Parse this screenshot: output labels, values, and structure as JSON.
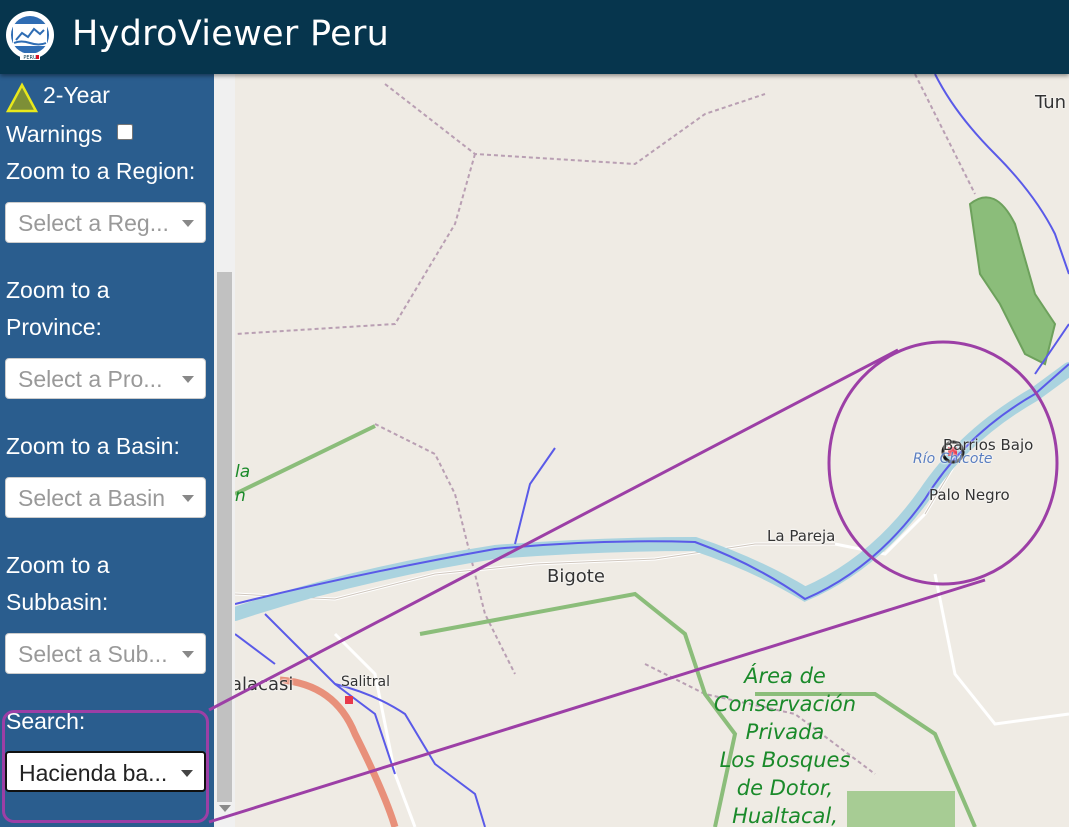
{
  "header": {
    "title": "HydroViewer Peru",
    "logo_text": "PERU"
  },
  "sidebar": {
    "warning_label": "2-Year",
    "warning_label_2": "Warnings",
    "region_label": "Zoom to a Region:",
    "region_placeholder": "Select a Reg...",
    "province_label_1": "Zoom to a",
    "province_label_2": "Province:",
    "province_placeholder": "Select a Pro...",
    "basin_label": "Zoom to a Basin:",
    "basin_placeholder": "Select a Basin",
    "subbasin_label_1": "Zoom to a",
    "subbasin_label_2": "Subbasin:",
    "subbasin_placeholder": "Select a Sub...",
    "search_label": "Search:",
    "search_value": "Hacienda ba..."
  },
  "map": {
    "places": {
      "tun": "Tun",
      "barrios_bajo": "Barrios Bajo",
      "rio": "Río Chicote",
      "palo_negro": "Palo Negro",
      "la_pareja": "La Pareja",
      "bigote": "Bigote",
      "salitral": "Salitral",
      "malacasi": "alacasi",
      "edge_a": "la",
      "edge_b": "n"
    },
    "area": [
      "Área de",
      "Conservación",
      "Privada",
      "Los Bosques",
      "de Dotor,",
      "Hualtacal,"
    ]
  },
  "colors": {
    "header_bg": "#06354d",
    "sidebar_bg": "#2a5d8e",
    "highlight": "#9c3fa6",
    "river": "#5a5ae8",
    "river_fill": "#aad3df",
    "protected_area": "#1a8a2a"
  }
}
